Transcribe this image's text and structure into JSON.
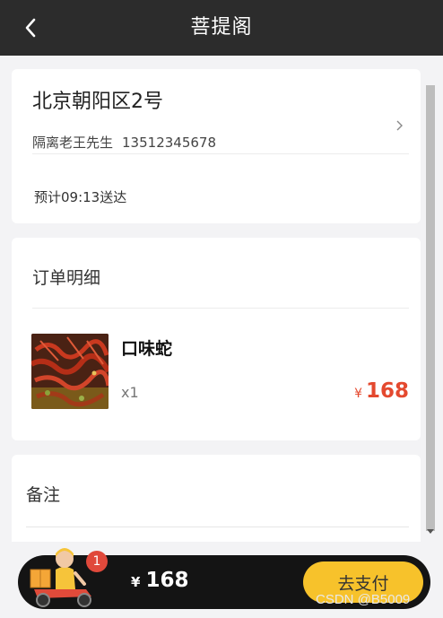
{
  "header": {
    "title": "菩提阁"
  },
  "address": {
    "line": "北京朝阳区2号",
    "contact_name": "隔离老王先生",
    "phone": "13512345678",
    "eta": "预计09:13送达"
  },
  "order": {
    "title": "订单明细",
    "items": [
      {
        "name": "口味蛇",
        "qty": "x1",
        "currency": "¥",
        "price": "168"
      }
    ]
  },
  "remark": {
    "title": "备注",
    "placeholder": ""
  },
  "cart": {
    "badge": "1",
    "currency": "¥",
    "total": "168",
    "pay_label": "去支付"
  },
  "watermark": "CSDN @B5009",
  "colors": {
    "header_bg": "#2c2c2c",
    "accent": "#f7c22b",
    "price": "#e4492f",
    "badge": "#e0493b"
  }
}
